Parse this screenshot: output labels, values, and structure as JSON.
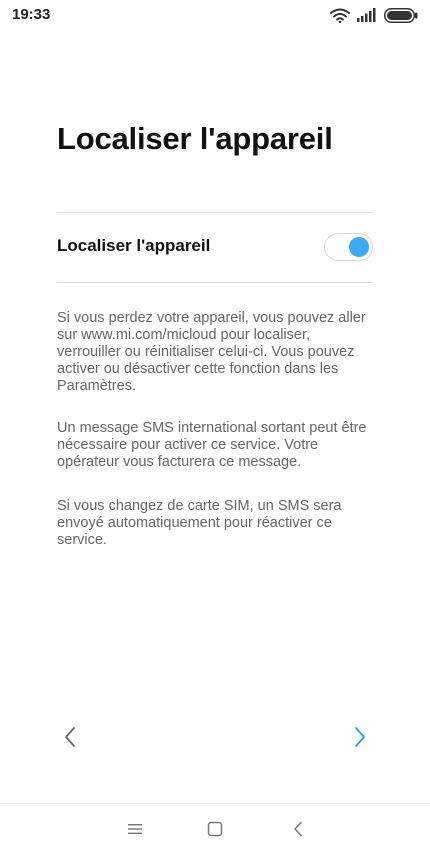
{
  "status_bar": {
    "time": "19:33",
    "icons": [
      "wifi-icon",
      "signal-icon",
      "battery-icon"
    ]
  },
  "page": {
    "title": "Localiser l'appareil"
  },
  "setting": {
    "label": "Localiser l'appareil",
    "enabled": true,
    "accent_color": "#3aaaf5"
  },
  "paragraphs": [
    "Si vous perdez votre appareil, vous pouvez aller sur www.mi.com/micloud pour localiser, verrouiller ou réinitialiser celui-ci. Vous pouvez activer ou désactiver cette fonction dans les Paramètres.",
    "Un message SMS international sortant peut être nécessaire pour activer ce service. Votre opérateur vous facturera ce message.",
    "Si vous changez de carte SIM, un SMS sera envoyé automatiquement pour réactiver ce service."
  ],
  "pager": {
    "prev_icon": "chevron-left-icon",
    "next_icon": "chevron-right-icon",
    "next_color": "#3aaaf5"
  },
  "nav_bar": {
    "icons": [
      "menu-icon",
      "home-icon",
      "back-icon"
    ]
  }
}
